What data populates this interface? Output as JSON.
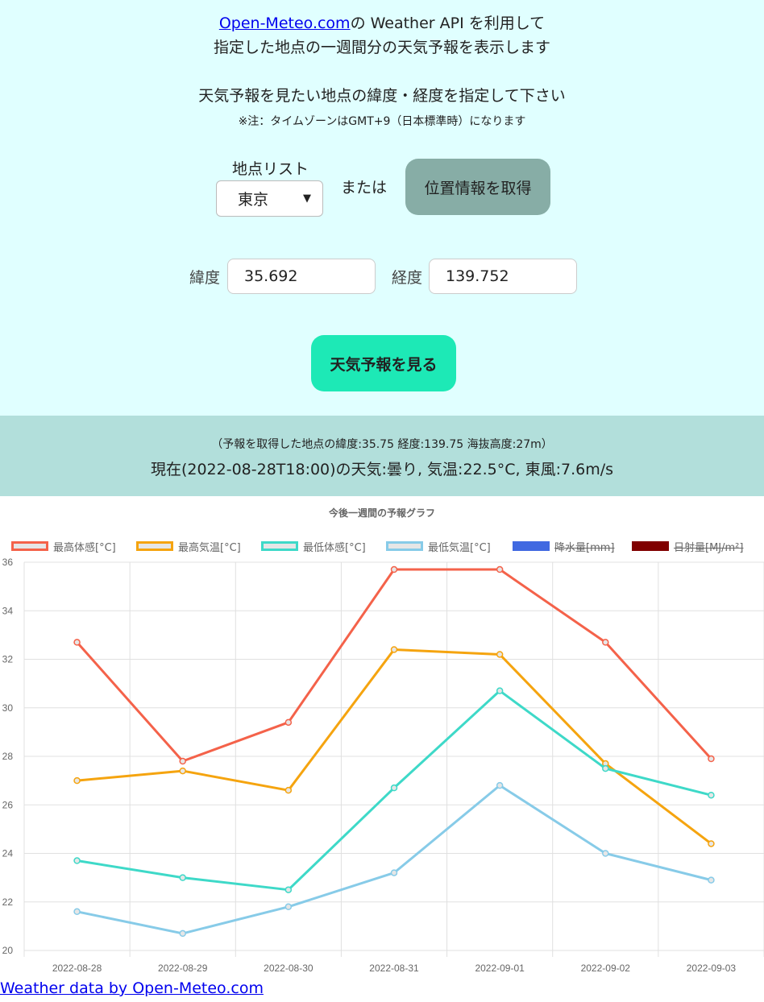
{
  "intro": {
    "link_text": "Open-Meteo.com",
    "line1_rest": "の Weather API を利用して",
    "line2": "指定した地点の一週間分の天気予報を表示します",
    "instruction": "天気予報を見たい地点の緯度・経度を指定して下さい",
    "note": "※注：タイムゾーンはGMT+9（日本標準時）になります"
  },
  "location": {
    "list_label": "地点リスト",
    "selected": "東京",
    "or_text": "または",
    "geo_button": "位置情報を取得"
  },
  "coords": {
    "lat_label": "緯度",
    "lat_value": "35.692",
    "lon_label": "経度",
    "lon_value": "139.752"
  },
  "forecast_button": "天気予報を見る",
  "result": {
    "meta": "（予報を取得した地点の緯度:35.75 経度:139.75 海抜高度:27m）",
    "current": "現在(2022-08-28T18:00)の天気:曇り, 気温:22.5°C, 東風:7.6m/s"
  },
  "chart_data": {
    "type": "line",
    "title": "今後一週間の予報グラフ",
    "categories": [
      "2022-08-28",
      "2022-08-29",
      "2022-08-30",
      "2022-08-31",
      "2022-09-01",
      "2022-09-02",
      "2022-09-03"
    ],
    "ylim": [
      20,
      36
    ],
    "yticks": [
      20,
      22,
      24,
      26,
      28,
      30,
      32,
      34,
      36
    ],
    "grid": true,
    "legend_position": "top",
    "series": [
      {
        "name": "最高体感[°C]",
        "color": "#f4624a",
        "values": [
          32.7,
          27.8,
          29.4,
          35.7,
          35.7,
          32.7,
          27.9
        ],
        "visible": true
      },
      {
        "name": "最高気温[°C]",
        "color": "#f5a40f",
        "values": [
          27.0,
          27.4,
          26.6,
          32.4,
          32.2,
          27.7,
          24.4
        ],
        "visible": true
      },
      {
        "name": "最低体感[°C]",
        "color": "#3ed9c8",
        "values": [
          23.7,
          23.0,
          22.5,
          26.7,
          30.7,
          27.5,
          26.4
        ],
        "visible": true
      },
      {
        "name": "最低気温[°C]",
        "color": "#87cbe8",
        "values": [
          21.6,
          20.7,
          21.8,
          23.2,
          26.8,
          24.0,
          22.9
        ],
        "visible": true
      },
      {
        "name": "降水量[mm]",
        "color": "#4169e1",
        "values": [],
        "visible": false
      },
      {
        "name": "日射量[MJ/m²]",
        "color": "#800000",
        "values": [],
        "visible": false
      }
    ]
  },
  "footer": {
    "link_text": "Weather data by Open-Meteo.com"
  }
}
